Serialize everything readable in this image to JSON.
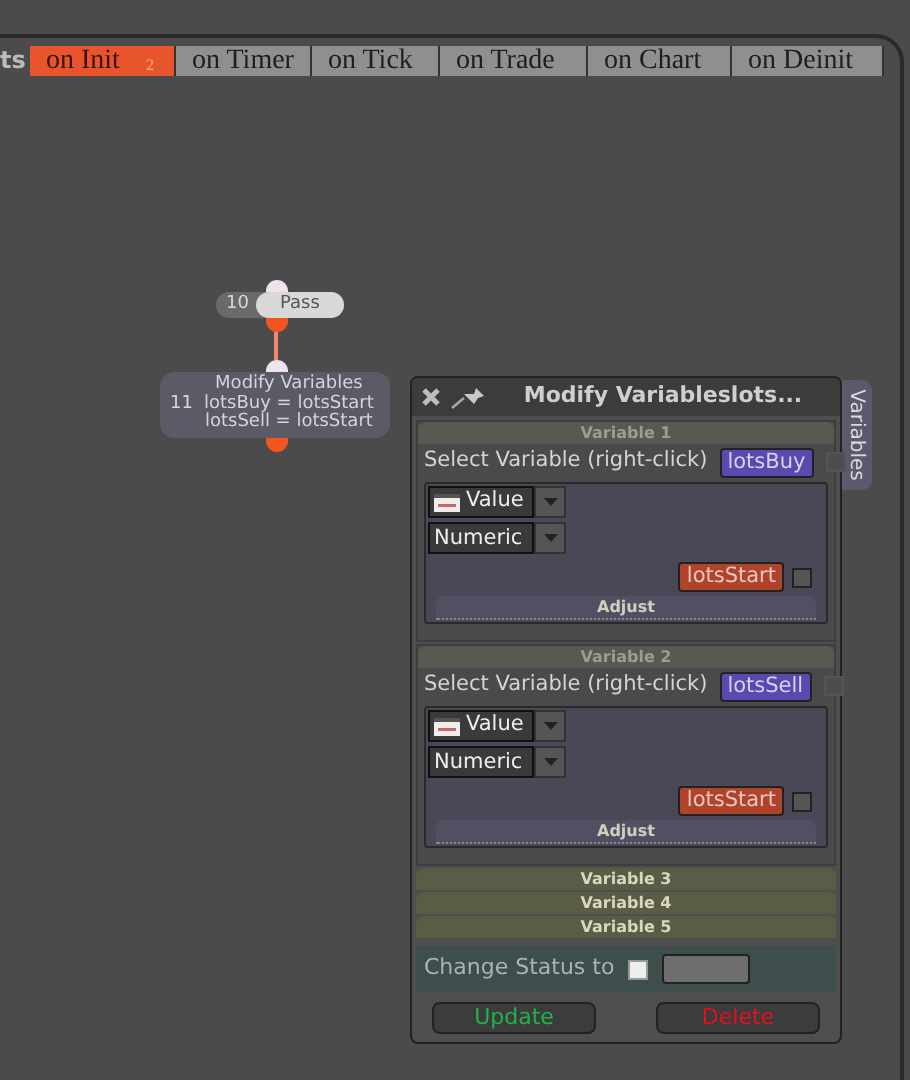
{
  "header": {
    "title_fragment": "ts"
  },
  "tabs": [
    {
      "label": "on Init",
      "badge": "2",
      "selected": true
    },
    {
      "label": "on Timer",
      "selected": false
    },
    {
      "label": "on Tick",
      "selected": false
    },
    {
      "label": "on Trade",
      "selected": false
    },
    {
      "label": "on Chart",
      "selected": false
    },
    {
      "label": "on Deinit",
      "selected": false
    }
  ],
  "nodes": [
    {
      "number": "10",
      "kind": "pill",
      "lines": [
        "Pass"
      ]
    },
    {
      "number": "11",
      "kind": "box",
      "lines": [
        "Modify Variables",
        "lotsBuy = lotsStart",
        "lotsSell = lotsStart"
      ]
    }
  ],
  "panel": {
    "title": "Modify Variableslots...",
    "side_tab": "Variables",
    "variables": [
      {
        "header": "Variable 1",
        "expanded": true,
        "select_label": "Select Variable (right-click)",
        "variable": "lotsBuy",
        "variable_checked": false,
        "type": "Value",
        "format": "Numeric",
        "value": "lotsStart",
        "value_checked": false,
        "button": "Adjust"
      },
      {
        "header": "Variable 2",
        "expanded": true,
        "select_label": "Select Variable (right-click)",
        "variable": "lotsSell",
        "variable_checked": false,
        "type": "Value",
        "format": "Numeric",
        "value": "lotsStart",
        "value_checked": false,
        "button": "Adjust"
      },
      {
        "header": "Variable 3",
        "expanded": false
      },
      {
        "header": "Variable 4",
        "expanded": false
      },
      {
        "header": "Variable 5",
        "expanded": false
      }
    ],
    "status": {
      "label": "Change Status to",
      "checked": false
    },
    "buttons": [
      {
        "label": "Update",
        "kind": "update"
      },
      {
        "label": "Delete",
        "kind": "delete"
      }
    ]
  }
}
